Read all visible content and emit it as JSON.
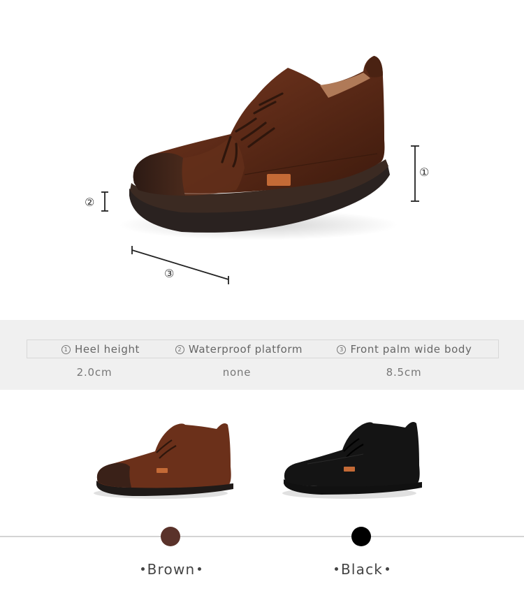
{
  "hero": {
    "markers": {
      "heel": "①",
      "platform": "②",
      "width": "③"
    }
  },
  "spec": {
    "headers": [
      {
        "num": "1",
        "label": "Heel height"
      },
      {
        "num": "2",
        "label": "Waterproof platform"
      },
      {
        "num": "3",
        "label": "Front palm wide body"
      }
    ],
    "values": [
      "2.0cm",
      "none",
      "8.5cm"
    ]
  },
  "colors": {
    "options": [
      {
        "name": "Brown",
        "hex": "#5a322a"
      },
      {
        "name": "Black",
        "hex": "#000000"
      }
    ]
  }
}
